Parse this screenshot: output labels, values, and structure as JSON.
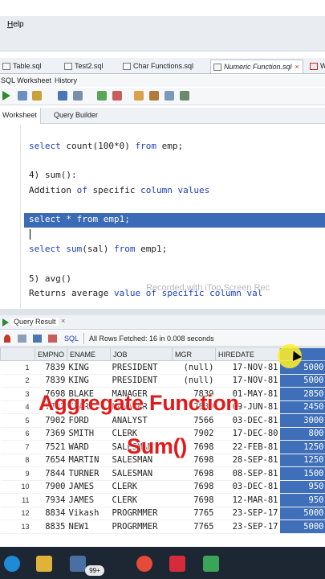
{
  "menu": {
    "help_label": "Help"
  },
  "file_tabs": [
    {
      "label": "Table.sql"
    },
    {
      "label": "Test2.sql"
    },
    {
      "label": "Char Functions.sql"
    },
    {
      "label": "Numeric Function.sql"
    },
    {
      "label": "W"
    }
  ],
  "subtabs": {
    "worksheet": "SQL Worksheet",
    "history": "History"
  },
  "worksheet_tabs": {
    "worksheet": "Worksheet",
    "query_builder": "Query Builder"
  },
  "editor": {
    "line1_kw1": "select",
    "line1_a": " count(100*0) ",
    "line1_kw2": "from",
    "line1_b": " emp;",
    "line2": "4) sum():",
    "line3_a": "Addition ",
    "line3_kw": "of",
    "line3_b": " specific ",
    "line3_kw2": "column values",
    "line4_kw1": "select",
    "line4_a": " * ",
    "line4_kw2": "from",
    "line4_b": " emp1;",
    "line5_kw1": "select",
    "line5_a": " ",
    "line5_kw2": "sum",
    "line5_b": "(sal) ",
    "line5_kw3": "from",
    "line5_c": " emp1;",
    "line6": "5) avg()",
    "line7_a": "Returns average ",
    "line7_kw": "value of specific column val",
    "watermark": "Recorded with iTop Screen Rec"
  },
  "results": {
    "tab_label": "Query Result",
    "sql_label": "SQL",
    "status": "All Rows Fetched: 16 in 0.008 seconds",
    "columns": [
      "EMPNO",
      "ENAME",
      "JOB",
      "MGR",
      "HIREDATE"
    ],
    "rows": [
      {
        "n": "1",
        "empno": "7839",
        "ename": "KING",
        "job": "PRESIDENT",
        "mgr": "(null)",
        "date": "17-NOV-81",
        "sal": "5000"
      },
      {
        "n": "2",
        "empno": "7839",
        "ename": "KING",
        "job": "PRESIDENT",
        "mgr": "(null)",
        "date": "17-NOV-81",
        "sal": "5000"
      },
      {
        "n": "3",
        "empno": "7698",
        "ename": "BLAKE",
        "job": "MANAGER",
        "mgr": "7839",
        "date": "01-MAY-81",
        "sal": "2850"
      },
      {
        "n": "4",
        "empno": "7782",
        "ename": "CLARK",
        "job": "MANAGER",
        "mgr": "7839",
        "date": "09-JUN-81",
        "sal": "2450"
      },
      {
        "n": "5",
        "empno": "7902",
        "ename": "FORD",
        "job": "ANALYST",
        "mgr": "7566",
        "date": "03-DEC-81",
        "sal": "3000"
      },
      {
        "n": "6",
        "empno": "7369",
        "ename": "SMITH",
        "job": "CLERK",
        "mgr": "7902",
        "date": "17-DEC-80",
        "sal": "800"
      },
      {
        "n": "7",
        "empno": "7521",
        "ename": "WARD",
        "job": "SALESMAN",
        "mgr": "7698",
        "date": "22-FEB-81",
        "sal": "1250"
      },
      {
        "n": "8",
        "empno": "7654",
        "ename": "MARTIN",
        "job": "SALESMAN",
        "mgr": "7698",
        "date": "28-SEP-81",
        "sal": "1250"
      },
      {
        "n": "9",
        "empno": "7844",
        "ename": "TURNER",
        "job": "SALESMAN",
        "mgr": "7698",
        "date": "08-SEP-81",
        "sal": "1500"
      },
      {
        "n": "10",
        "empno": "7900",
        "ename": "JAMES",
        "job": "CLERK",
        "mgr": "7698",
        "date": "03-DEC-81",
        "sal": "950"
      },
      {
        "n": "11",
        "empno": "7934",
        "ename": "JAMES",
        "job": "CLERK",
        "mgr": "7698",
        "date": "12-MAR-81",
        "sal": "950"
      },
      {
        "n": "12",
        "empno": "8834",
        "ename": "Vikash",
        "job": "PROGRMMER",
        "mgr": "7765",
        "date": "23-SEP-17",
        "sal": "5000"
      },
      {
        "n": "13",
        "empno": "8835",
        "ename": "NEW1",
        "job": "PROGRMMER",
        "mgr": "7765",
        "date": "23-SEP-17",
        "sal": "5000"
      }
    ]
  },
  "overlay": {
    "title": "Aggregate Function",
    "subtitle": "Sum()"
  },
  "taskbar": {
    "badge": "99+"
  },
  "colors": {
    "highlight": "#3b6bb6",
    "keyword": "#1e40b8",
    "overlay_text": "#e01a1a",
    "taskbar": "#1d2733"
  }
}
